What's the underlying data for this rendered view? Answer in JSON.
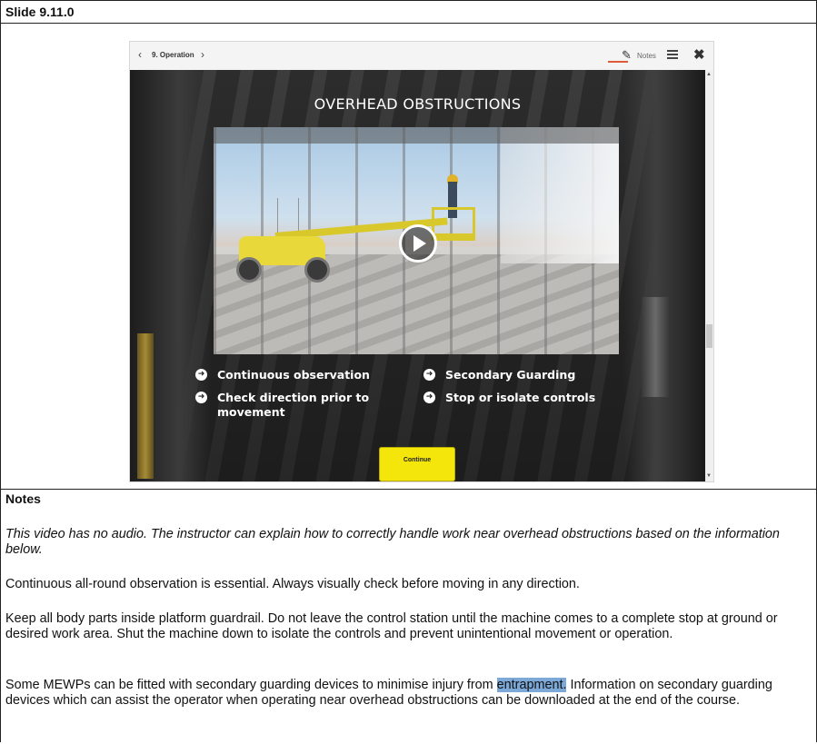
{
  "slide": {
    "title": "Slide 9.11.0"
  },
  "viewer": {
    "topbar": {
      "prev_icon": "‹",
      "breadcrumb": "9. Operation",
      "next_icon": "›",
      "notes_label": "Notes",
      "close_icon": "✖"
    },
    "heading": "OVERHEAD OBSTRUCTIONS",
    "bullets": [
      {
        "text": "Continuous observation"
      },
      {
        "text": "Check direction prior to movement"
      },
      {
        "text": "Secondary Guarding"
      },
      {
        "text": "Stop or isolate controls"
      }
    ],
    "continue_label": "Continue",
    "icons": {
      "play": "play-icon",
      "bullet": "arrow-right-icon",
      "notes": "pencil-icon",
      "menu": "hamburger-menu-icon",
      "close": "close-icon"
    },
    "colors": {
      "continue_button": "#f4e50a",
      "lift": "#e8d83a",
      "accent_underline": "#e05a36"
    }
  },
  "notes": {
    "heading": "Notes",
    "paragraph1": "This video has no audio. The instructor can explain how to correctly handle work near overhead obstructions based on the information below.",
    "paragraph2": "Continuous all-round observation is essential. Always visually check before moving in any direction.",
    "paragraph3": "Keep all body parts inside platform guardrail. Do not leave the control station until the machine comes to a complete stop at ground or desired work area. Shut the machine down to isolate the controls and prevent unintentional movement or operation.",
    "paragraph4_before": "Some MEWPs can be fitted with secondary guarding devices to minimise injury from ",
    "paragraph4_highlight": "entrapment.",
    "paragraph4_after": " Information on secondary guarding devices which can assist the operator when operating near overhead obstructions can be downloaded at the end of the course."
  }
}
